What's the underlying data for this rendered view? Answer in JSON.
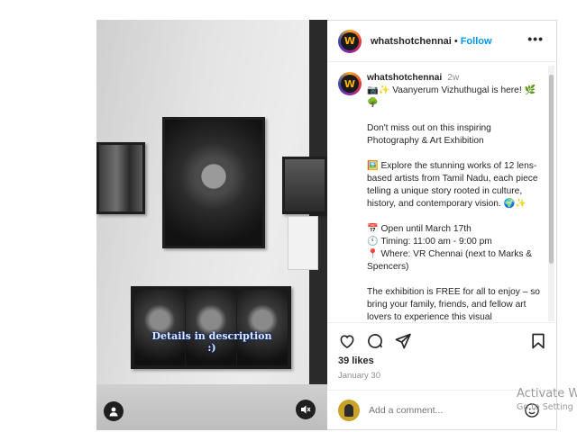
{
  "media": {
    "overlay_text": "Details in description :)"
  },
  "post": {
    "header": {
      "username": "whatshotchennai",
      "separator": "•",
      "follow_label": "Follow",
      "more_label": "•••"
    },
    "caption": {
      "username": "whatshotchennai",
      "time": "2w",
      "lines": [
        "📷✨ Vaanyerum Vizhuthugal is here! 🌿🌳",
        "",
        "Don't miss out on this inspiring Photography & Art Exhibition",
        "",
        "🖼️ Explore the stunning works of 12 lens-based artists from Tamil Nadu, each piece telling a unique story rooted in culture, history, and contemporary vision. 🌍✨",
        "",
        "📅 Open until March 17th",
        "🕚 Timing: 11:00 am - 9:00 pm",
        "📍 Where: VR Chennai (next to Marks & Spencers)",
        "",
        "The exhibition is FREE for all to enjoy – so bring your family, friends, and fellow art lovers to experience this visual"
      ]
    },
    "likes": "39 likes",
    "date": "January 30",
    "comment_placeholder": "Add a comment..."
  },
  "watermark": {
    "line1": "Activate W",
    "line2": "Go to Setting"
  }
}
